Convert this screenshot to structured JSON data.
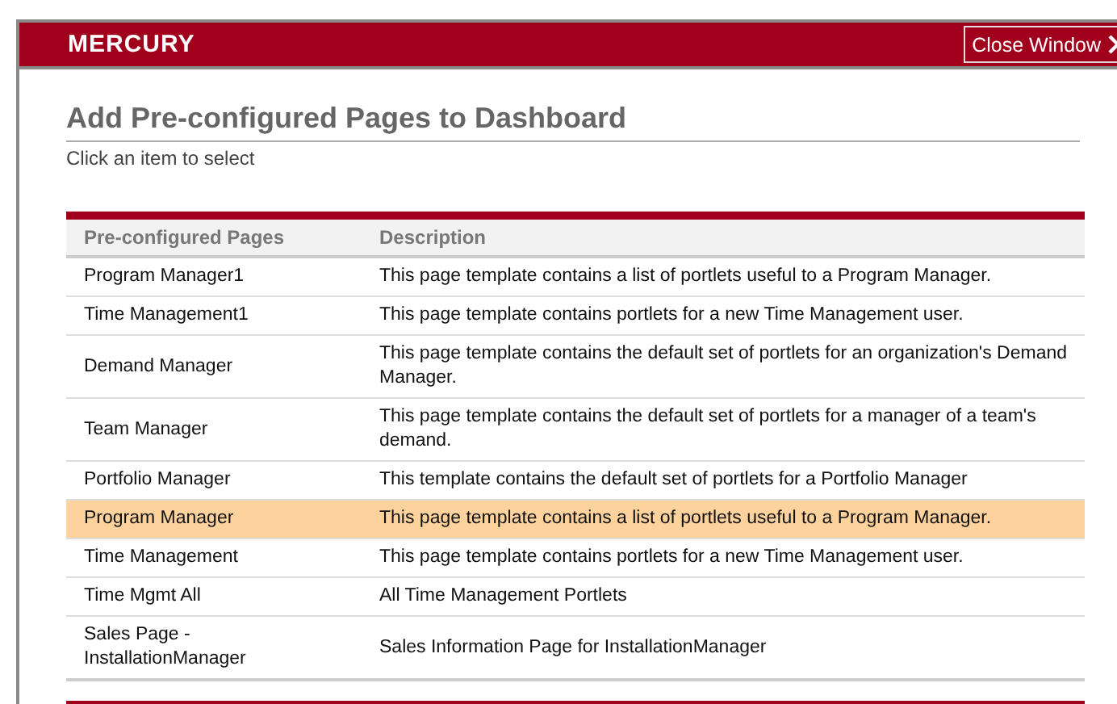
{
  "header": {
    "logo": "MERCURY",
    "close_button": "Close Window"
  },
  "title": "Add Pre-configured Pages to Dashboard",
  "subtitle": "Click an item to select",
  "table": {
    "columns": [
      "Pre-configured Pages",
      "Description"
    ],
    "rows": [
      {
        "page": "Program Manager1",
        "description": "This page template contains a list of portlets useful to a Program Manager.",
        "selected": false
      },
      {
        "page": "Time Management1",
        "description": "This page template contains portlets for a new Time Management user.",
        "selected": false
      },
      {
        "page": "Demand Manager",
        "description": "This page template contains the default set of portlets for an organization's Demand Manager.",
        "selected": false
      },
      {
        "page": "Team Manager",
        "description": "This page template contains the default set of portlets for a manager of a team's demand.",
        "selected": false
      },
      {
        "page": "Portfolio Manager",
        "description": "This template contains the default set of portlets for a Portfolio Manager",
        "selected": false
      },
      {
        "page": "Program Manager",
        "description": "This page template contains a list of portlets useful to a Program Manager.",
        "selected": true
      },
      {
        "page": "Time Management",
        "description": "This page template contains portlets for a new Time Management user.",
        "selected": false
      },
      {
        "page": "Time Mgmt All",
        "description": "All Time Management Portlets",
        "selected": false
      },
      {
        "page": "Sales Page - InstallationManager",
        "description": "Sales Information Page for InstallationManager",
        "selected": false
      }
    ]
  }
}
